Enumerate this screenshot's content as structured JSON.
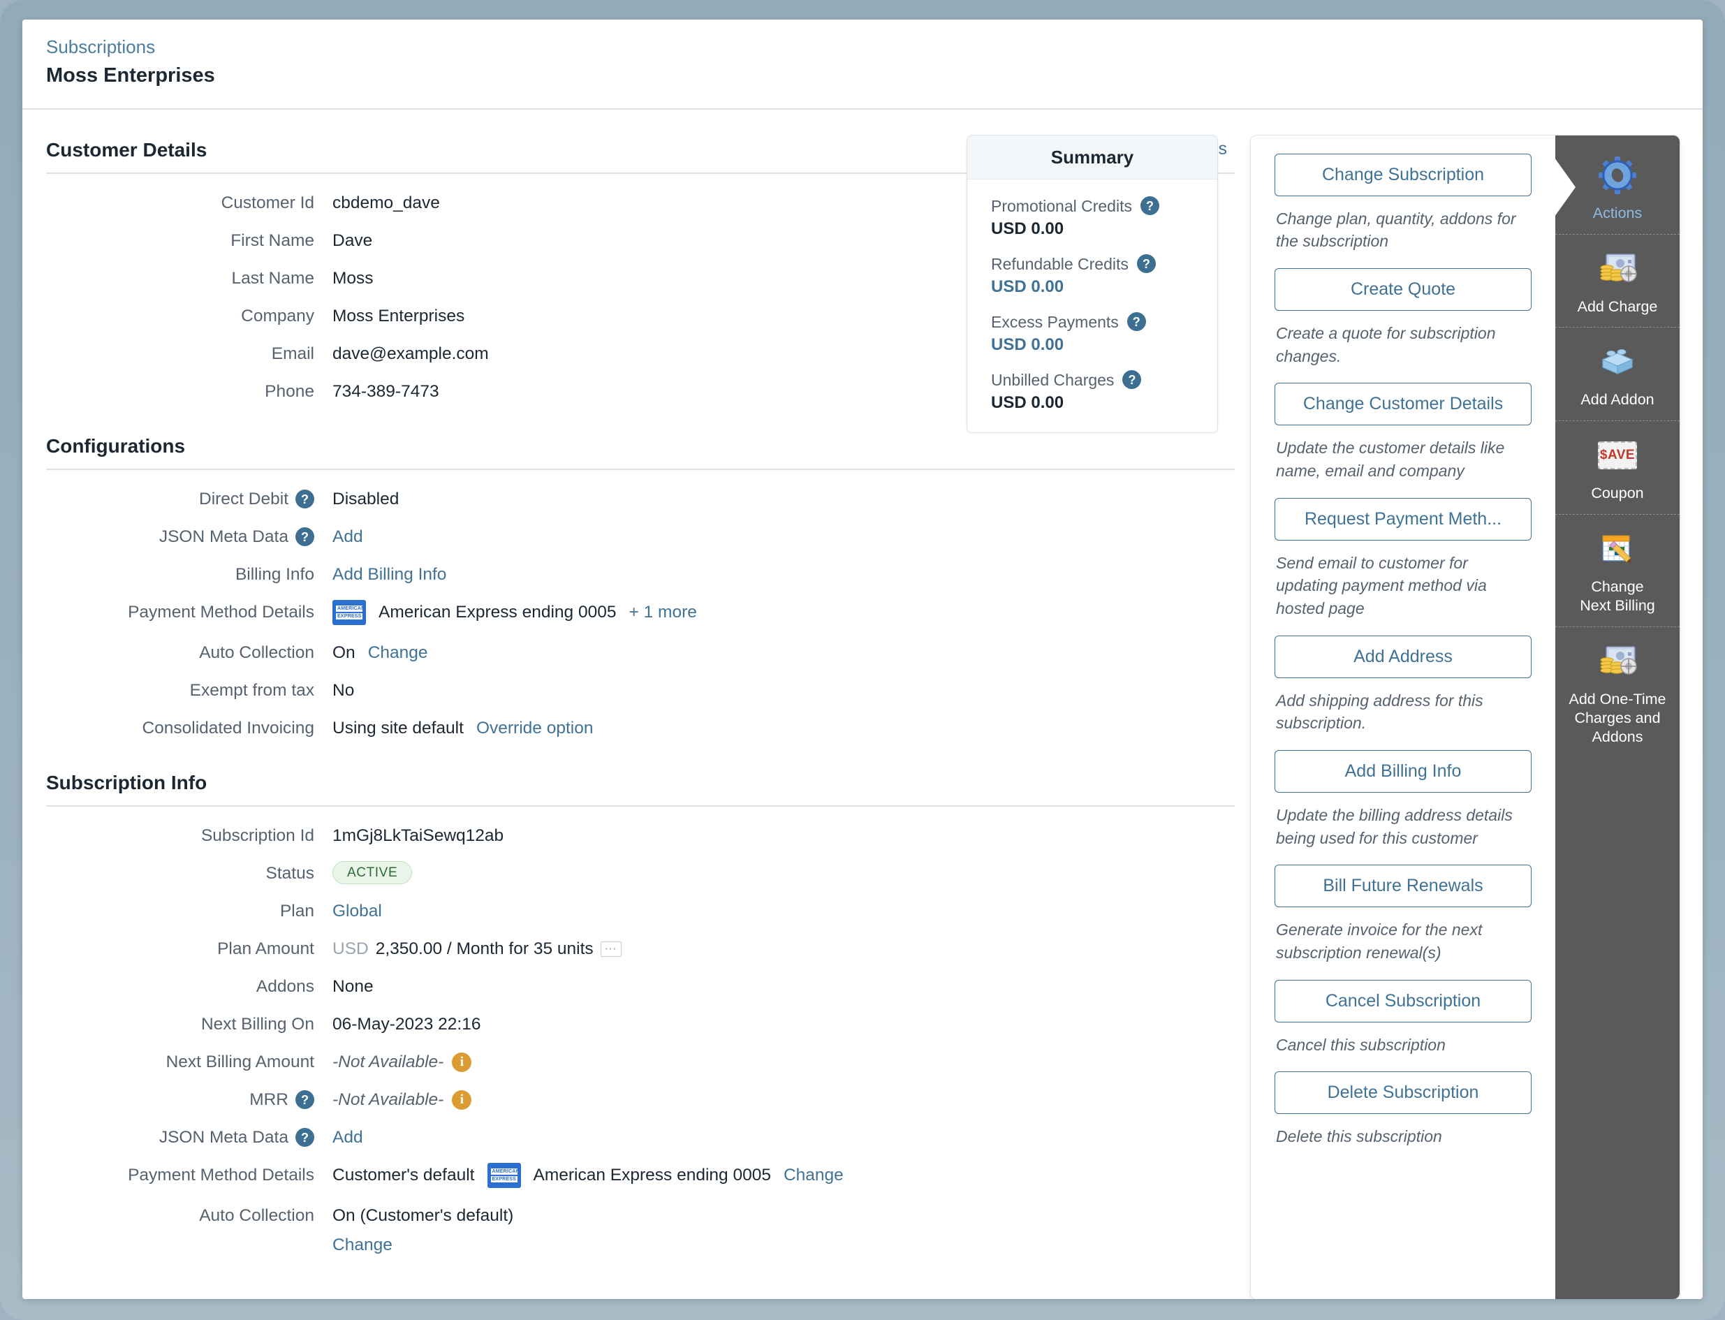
{
  "header": {
    "breadcrumb": "Subscriptions",
    "title": "Moss Enterprises"
  },
  "customer_details": {
    "heading": "Customer Details",
    "view_link": "View Customer Details",
    "fields": [
      {
        "label": "Customer Id",
        "value": "cbdemo_dave"
      },
      {
        "label": "First Name",
        "value": "Dave"
      },
      {
        "label": "Last Name",
        "value": "Moss"
      },
      {
        "label": "Company",
        "value": "Moss Enterprises"
      },
      {
        "label": "Email",
        "value": "dave@example.com"
      },
      {
        "label": "Phone",
        "value": "734-389-7473"
      }
    ]
  },
  "summary": {
    "title": "Summary",
    "items": [
      {
        "label": "Promotional Credits",
        "value": "USD 0.00",
        "is_link": false
      },
      {
        "label": "Refundable Credits",
        "value": "USD 0.00",
        "is_link": true
      },
      {
        "label": "Excess Payments",
        "value": "USD 0.00",
        "is_link": true
      },
      {
        "label": "Unbilled Charges",
        "value": "USD 0.00",
        "is_link": false
      }
    ]
  },
  "configurations": {
    "heading": "Configurations",
    "direct_debit_label": "Direct Debit",
    "direct_debit_value": "Disabled",
    "json_meta_label": "JSON Meta Data",
    "json_meta_link": "Add",
    "billing_info_label": "Billing Info",
    "billing_info_link": "Add Billing Info",
    "payment_method_label": "Payment Method Details",
    "payment_method_value": "American Express ending 0005",
    "payment_method_more": "+ 1 more",
    "auto_collection_label": "Auto Collection",
    "auto_collection_value": "On",
    "auto_collection_change": "Change",
    "exempt_tax_label": "Exempt from tax",
    "exempt_tax_value": "No",
    "consolidated_label": "Consolidated Invoicing",
    "consolidated_value": "Using site default",
    "consolidated_link": "Override option",
    "card_brand_line1": "AMERICAN",
    "card_brand_line2": "EXPRESS"
  },
  "subscription_info": {
    "heading": "Subscription Info",
    "subscription_id_label": "Subscription Id",
    "subscription_id_value": "1mGj8LkTaiSewq12ab",
    "status_label": "Status",
    "status_value": "ACTIVE",
    "plan_label": "Plan",
    "plan_value": "Global",
    "plan_amount_label": "Plan Amount",
    "plan_amount_currency": "USD",
    "plan_amount_value": "2,350.00 / Month for 35 units",
    "plan_amount_ellipsis": "…",
    "addons_label": "Addons",
    "addons_value": "None",
    "next_billing_on_label": "Next Billing On",
    "next_billing_on_value": "06-May-2023 22:16",
    "next_billing_amount_label": "Next Billing Amount",
    "next_billing_amount_value": "-Not Available-",
    "mrr_label": "MRR",
    "mrr_value": "-Not Available-",
    "json_meta_label": "JSON Meta Data",
    "json_meta_link": "Add",
    "payment_method_label": "Payment Method Details",
    "payment_method_prefix": "Customer's default",
    "payment_method_value": "American Express ending 0005",
    "payment_method_change": "Change",
    "auto_collection_label": "Auto Collection",
    "auto_collection_value": "On (Customer's default)",
    "auto_collection_change": "Change"
  },
  "actions_panel": {
    "items": [
      {
        "button": "Change Subscription",
        "desc": "Change plan, quantity, addons for the subscription"
      },
      {
        "button": "Create Quote",
        "desc": "Create a quote for subscription changes."
      },
      {
        "button": "Change Customer Details",
        "desc": "Update the customer details like name, email and company"
      },
      {
        "button": "Request Payment Meth...",
        "desc": "Send email to customer for updating payment method via hosted page"
      },
      {
        "button": "Add Address",
        "desc": "Add shipping address for this subscription."
      },
      {
        "button": "Add Billing Info",
        "desc": "Update the billing address details being used for this customer"
      },
      {
        "button": "Bill Future Renewals",
        "desc": "Generate invoice for the next subscription renewal(s)"
      },
      {
        "button": "Cancel Subscription",
        "desc": "Cancel this subscription"
      },
      {
        "button": "Delete Subscription",
        "desc": "Delete this subscription"
      }
    ]
  },
  "icon_rail": {
    "items": [
      {
        "label": "Actions",
        "icon": "gear-icon",
        "active": true
      },
      {
        "label": "Add Charge",
        "icon": "money-charge-icon",
        "active": false
      },
      {
        "label": "Add Addon",
        "icon": "brick-addon-icon",
        "active": false
      },
      {
        "label": "Coupon",
        "icon": "save-coupon-icon",
        "active": false,
        "glyph": "$AVE"
      },
      {
        "label": "Change\nNext Billing",
        "icon": "calendar-edit-icon",
        "active": false
      },
      {
        "label": "Add One-Time\nCharges and\nAddons",
        "icon": "money-charge-icon",
        "active": false
      }
    ]
  },
  "colors": {
    "link": "#3f7296",
    "frame": "#9fb4c0",
    "rail": "#5a5a5a",
    "badge_text": "#2f6b34",
    "warning": "#dd9b33",
    "amex": "#2b6fd0"
  }
}
